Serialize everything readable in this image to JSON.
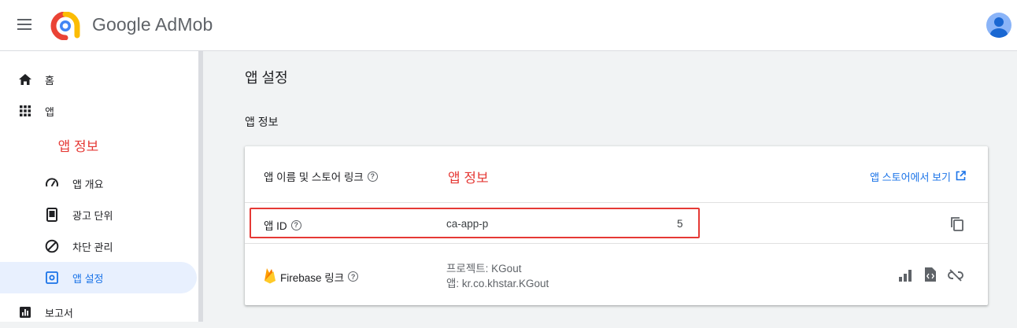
{
  "header": {
    "brand": "Google AdMob",
    "menu_icon": "hamburger-menu-icon",
    "avatar_icon": "account-avatar-icon"
  },
  "sidebar": {
    "items": [
      {
        "label": "홈",
        "icon": "home-icon"
      },
      {
        "label": "앱",
        "icon": "apps-grid-icon"
      },
      {
        "label": "앱 개요",
        "icon": "speedometer-icon"
      },
      {
        "label": "광고 단위",
        "icon": "phone-ad-unit-icon"
      },
      {
        "label": "차단 관리",
        "icon": "block-icon"
      },
      {
        "label": "앱 설정",
        "icon": "settings-gear-icon"
      },
      {
        "label": "보고서",
        "icon": "bar-chart-icon"
      }
    ],
    "annotation": "앱 정보"
  },
  "main": {
    "page_title": "앱 설정",
    "section_title": "앱 정보",
    "rows": {
      "name": {
        "label": "앱 이름 및 스토어 링크",
        "annotation": "앱 정보",
        "link_label": "앱 스토어에서 보기"
      },
      "app_id": {
        "label": "앱 ID",
        "value": "ca-app-p",
        "value_suffix": "5"
      },
      "firebase": {
        "label": "Firebase 링크",
        "project": "프로젝트: KGout",
        "app": "앱: kr.co.khstar.KGout"
      }
    }
  },
  "colors": {
    "accent": "#1a73e8",
    "annotation_red": "#e53935",
    "active_nav_bg": "#e8f0fe"
  }
}
